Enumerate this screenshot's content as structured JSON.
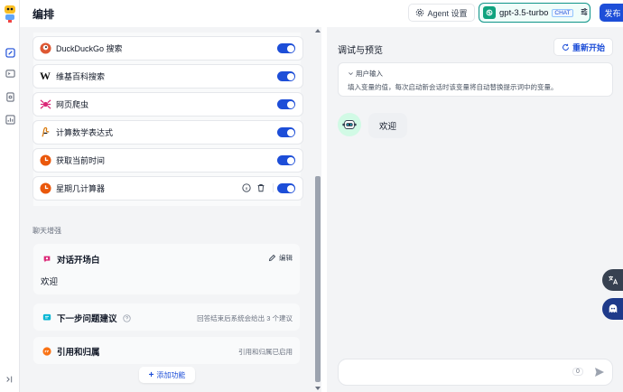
{
  "header": {
    "title": "编排",
    "agent_settings": "Agent 设置",
    "model_name": "gpt-3.5-turbo",
    "model_badge": "CHAT",
    "publish": "发布"
  },
  "tools": [
    {
      "label": "DuckDuckGo 搜索",
      "icon": "duckduckgo-icon",
      "enabled": true
    },
    {
      "label": "维基百科搜索",
      "icon": "wikipedia-icon",
      "enabled": true
    },
    {
      "label": "网页爬虫",
      "icon": "spider-icon",
      "enabled": true
    },
    {
      "label": "计算数学表达式",
      "icon": "math-icon",
      "enabled": true
    },
    {
      "label": "获取当前时间",
      "icon": "clock-icon",
      "enabled": true
    },
    {
      "label": "星期几计算器",
      "icon": "clock-icon",
      "enabled": true
    }
  ],
  "chat_enhance": {
    "section_label": "聊天增强",
    "opener": {
      "title": "对话开场白",
      "edit": "编辑",
      "content": "欢迎"
    },
    "suggestions": {
      "title": "下一步问题建议",
      "desc": "回答结束后系统会给出 3 个建议"
    },
    "citation": {
      "title": "引用和归属",
      "desc": "引用和归属已启用"
    },
    "add_feature": "添加功能"
  },
  "preview": {
    "title": "调试与预览",
    "restart": "重新开始",
    "user_inputs_title": "用户输入",
    "user_inputs_desc": "填入变量的值，每次启动新会话时该变量将自动替换提示词中的变量。",
    "bot_message": "欢迎",
    "char_count": "0",
    "input_placeholder": ""
  },
  "colors": {
    "accent": "#1d4ed8",
    "model_border": "#0d9488",
    "panel_bg": "#f3f4f6"
  }
}
